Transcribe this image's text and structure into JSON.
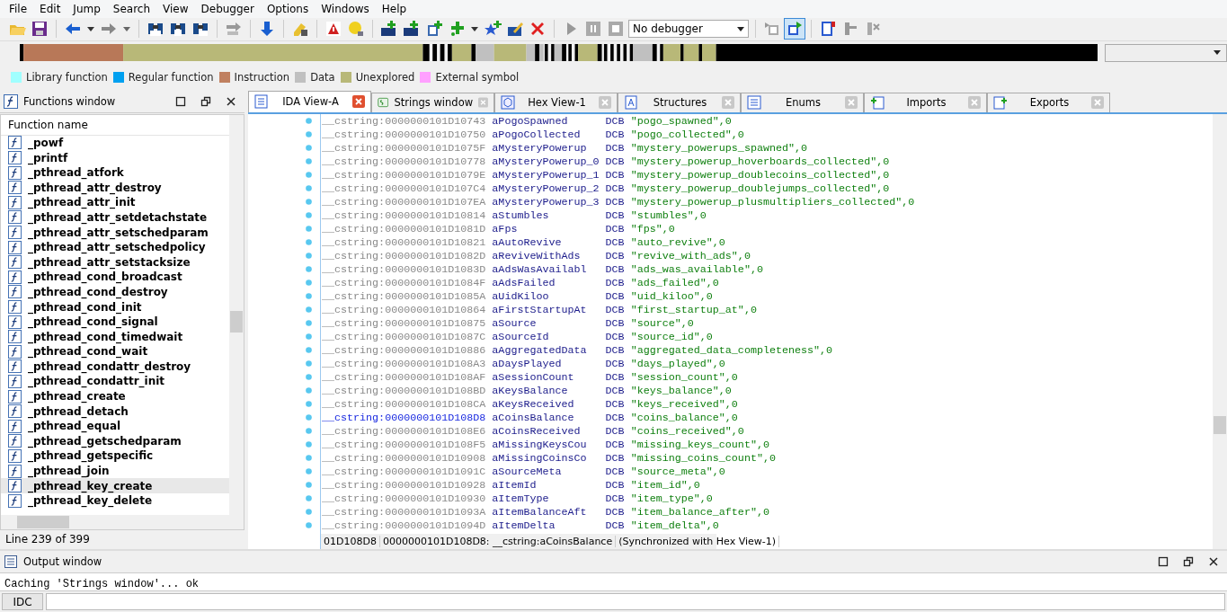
{
  "menu": [
    "File",
    "Edit",
    "Jump",
    "Search",
    "View",
    "Debugger",
    "Options",
    "Windows",
    "Help"
  ],
  "toolbar": {
    "debugger_select": "No debugger"
  },
  "legend": [
    {
      "label": "Library function",
      "color": "#a0ffff"
    },
    {
      "label": "Regular function",
      "color": "#00a0f0"
    },
    {
      "label": "Instruction",
      "color": "#c08060"
    },
    {
      "label": "Data",
      "color": "#c0c0c0"
    },
    {
      "label": "Unexplored",
      "color": "#b8b878"
    },
    {
      "label": "External symbol",
      "color": "#ffa0ff"
    }
  ],
  "functions_window": {
    "title": "Functions window",
    "column": "Function name",
    "status": "Line 239 of 399",
    "items": [
      {
        "name": "_powf",
        "selected": false
      },
      {
        "name": "_printf",
        "selected": false
      },
      {
        "name": "_pthread_atfork",
        "selected": false
      },
      {
        "name": "_pthread_attr_destroy",
        "selected": false
      },
      {
        "name": "_pthread_attr_init",
        "selected": false
      },
      {
        "name": "_pthread_attr_setdetachstate",
        "selected": false
      },
      {
        "name": "_pthread_attr_setschedparam",
        "selected": false
      },
      {
        "name": "_pthread_attr_setschedpolicy",
        "selected": false
      },
      {
        "name": "_pthread_attr_setstacksize",
        "selected": false
      },
      {
        "name": "_pthread_cond_broadcast",
        "selected": false
      },
      {
        "name": "_pthread_cond_destroy",
        "selected": false
      },
      {
        "name": "_pthread_cond_init",
        "selected": false
      },
      {
        "name": "_pthread_cond_signal",
        "selected": false
      },
      {
        "name": "_pthread_cond_timedwait",
        "selected": false
      },
      {
        "name": "_pthread_cond_wait",
        "selected": false
      },
      {
        "name": "_pthread_condattr_destroy",
        "selected": false
      },
      {
        "name": "_pthread_condattr_init",
        "selected": false
      },
      {
        "name": "_pthread_create",
        "selected": false
      },
      {
        "name": "_pthread_detach",
        "selected": false
      },
      {
        "name": "_pthread_equal",
        "selected": false
      },
      {
        "name": "_pthread_getschedparam",
        "selected": false
      },
      {
        "name": "_pthread_getspecific",
        "selected": false
      },
      {
        "name": "_pthread_join",
        "selected": false
      },
      {
        "name": "_pthread_key_create",
        "selected": true
      },
      {
        "name": "_pthread_key_delete",
        "selected": false
      }
    ]
  },
  "tabs": [
    {
      "label": "IDA View-A",
      "selected": true,
      "kind": "listing"
    },
    {
      "label": "Strings window",
      "selected": false,
      "kind": "strings"
    },
    {
      "label": "Hex View-1",
      "selected": false,
      "kind": "hex"
    },
    {
      "label": "Structures",
      "selected": false,
      "kind": "structures"
    },
    {
      "label": "Enums",
      "selected": false,
      "kind": "enums"
    },
    {
      "label": "Imports",
      "selected": false,
      "kind": "imports"
    },
    {
      "label": "Exports",
      "selected": false,
      "kind": "exports"
    }
  ],
  "listing": [
    {
      "address": "__cstring:0000000101D10743",
      "label": "aPogoSpawned",
      "directive": "DCB",
      "operand": "\"pogo_spawned\",0",
      "current": false
    },
    {
      "address": "__cstring:0000000101D10750",
      "label": "aPogoCollected",
      "directive": "DCB",
      "operand": "\"pogo_collected\",0",
      "current": false
    },
    {
      "address": "__cstring:0000000101D1075F",
      "label": "aMysteryPowerup",
      "directive": "DCB",
      "operand": "\"mystery_powerups_spawned\",0",
      "current": false
    },
    {
      "address": "__cstring:0000000101D10778",
      "label": "aMysteryPowerup_0",
      "directive": "DCB",
      "operand": "\"mystery_powerup_hoverboards_collected\",0",
      "current": false
    },
    {
      "address": "__cstring:0000000101D1079E",
      "label": "aMysteryPowerup_1",
      "directive": "DCB",
      "operand": "\"mystery_powerup_doublecoins_collected\",0",
      "current": false
    },
    {
      "address": "__cstring:0000000101D107C4",
      "label": "aMysteryPowerup_2",
      "directive": "DCB",
      "operand": "\"mystery_powerup_doublejumps_collected\",0",
      "current": false
    },
    {
      "address": "__cstring:0000000101D107EA",
      "label": "aMysteryPowerup_3",
      "directive": "DCB",
      "operand": "\"mystery_powerup_plusmultipliers_collected\",0",
      "current": false
    },
    {
      "address": "__cstring:0000000101D10814",
      "label": "aStumbles",
      "directive": "DCB",
      "operand": "\"stumbles\",0",
      "current": false
    },
    {
      "address": "__cstring:0000000101D1081D",
      "label": "aFps",
      "directive": "DCB",
      "operand": "\"fps\",0",
      "current": false
    },
    {
      "address": "__cstring:0000000101D10821",
      "label": "aAutoRevive",
      "directive": "DCB",
      "operand": "\"auto_revive\",0",
      "current": false
    },
    {
      "address": "__cstring:0000000101D1082D",
      "label": "aReviveWithAds",
      "directive": "DCB",
      "operand": "\"revive_with_ads\",0",
      "current": false
    },
    {
      "address": "__cstring:0000000101D1083D",
      "label": "aAdsWasAvailabl",
      "directive": "DCB",
      "operand": "\"ads_was_available\",0",
      "current": false
    },
    {
      "address": "__cstring:0000000101D1084F",
      "label": "aAdsFailed",
      "directive": "DCB",
      "operand": "\"ads_failed\",0",
      "current": false
    },
    {
      "address": "__cstring:0000000101D1085A",
      "label": "aUidKiloo",
      "directive": "DCB",
      "operand": "\"uid_kiloo\",0",
      "current": false
    },
    {
      "address": "__cstring:0000000101D10864",
      "label": "aFirstStartupAt",
      "directive": "DCB",
      "operand": "\"first_startup_at\",0",
      "current": false
    },
    {
      "address": "__cstring:0000000101D10875",
      "label": "aSource",
      "directive": "DCB",
      "operand": "\"source\",0",
      "current": false
    },
    {
      "address": "__cstring:0000000101D1087C",
      "label": "aSourceId",
      "directive": "DCB",
      "operand": "\"source_id\",0",
      "current": false
    },
    {
      "address": "__cstring:0000000101D10886",
      "label": "aAggregatedData",
      "directive": "DCB",
      "operand": "\"aggregated_data_completeness\",0",
      "current": false
    },
    {
      "address": "__cstring:0000000101D108A3",
      "label": "aDaysPlayed",
      "directive": "DCB",
      "operand": "\"days_played\",0",
      "current": false
    },
    {
      "address": "__cstring:0000000101D108AF",
      "label": "aSessionCount",
      "directive": "DCB",
      "operand": "\"session_count\",0",
      "current": false
    },
    {
      "address": "__cstring:0000000101D108BD",
      "label": "aKeysBalance",
      "directive": "DCB",
      "operand": "\"keys_balance\",0",
      "current": false
    },
    {
      "address": "__cstring:0000000101D108CA",
      "label": "aKeysReceived",
      "directive": "DCB",
      "operand": "\"keys_received\",0",
      "current": false
    },
    {
      "address": "__cstring:0000000101D108D8",
      "label": "aCoinsBalance",
      "directive": "DCB",
      "operand": "\"coins_balance\",0",
      "current": true
    },
    {
      "address": "__cstring:0000000101D108E6",
      "label": "aCoinsReceived",
      "directive": "DCB",
      "operand": "\"coins_received\",0",
      "current": false
    },
    {
      "address": "__cstring:0000000101D108F5",
      "label": "aMissingKeysCou",
      "directive": "DCB",
      "operand": "\"missing_keys_count\",0",
      "current": false
    },
    {
      "address": "__cstring:0000000101D10908",
      "label": "aMissingCoinsCo",
      "directive": "DCB",
      "operand": "\"missing_coins_count\",0",
      "current": false
    },
    {
      "address": "__cstring:0000000101D1091C",
      "label": "aSourceMeta",
      "directive": "DCB",
      "operand": "\"source_meta\",0",
      "current": false
    },
    {
      "address": "__cstring:0000000101D10928",
      "label": "aItemId",
      "directive": "DCB",
      "operand": "\"item_id\",0",
      "current": false
    },
    {
      "address": "__cstring:0000000101D10930",
      "label": "aItemType",
      "directive": "DCB",
      "operand": "\"item_type\",0",
      "current": false
    },
    {
      "address": "__cstring:0000000101D1093A",
      "label": "aItemBalanceAft",
      "directive": "DCB",
      "operand": "\"item_balance_after\",0",
      "current": false
    },
    {
      "address": "__cstring:0000000101D1094D",
      "label": "aItemDelta",
      "directive": "DCB",
      "operand": "\"item_delta\",0",
      "current": false
    }
  ],
  "listing_status": [
    "01D108D8",
    "0000000101D108D8: __cstring:aCoinsBalance",
    "(Synchronized with Hex View-1)"
  ],
  "output_window": {
    "title": "Output window",
    "lines": [
      "Caching 'Strings window'... ok"
    ],
    "command_button": "IDC"
  }
}
